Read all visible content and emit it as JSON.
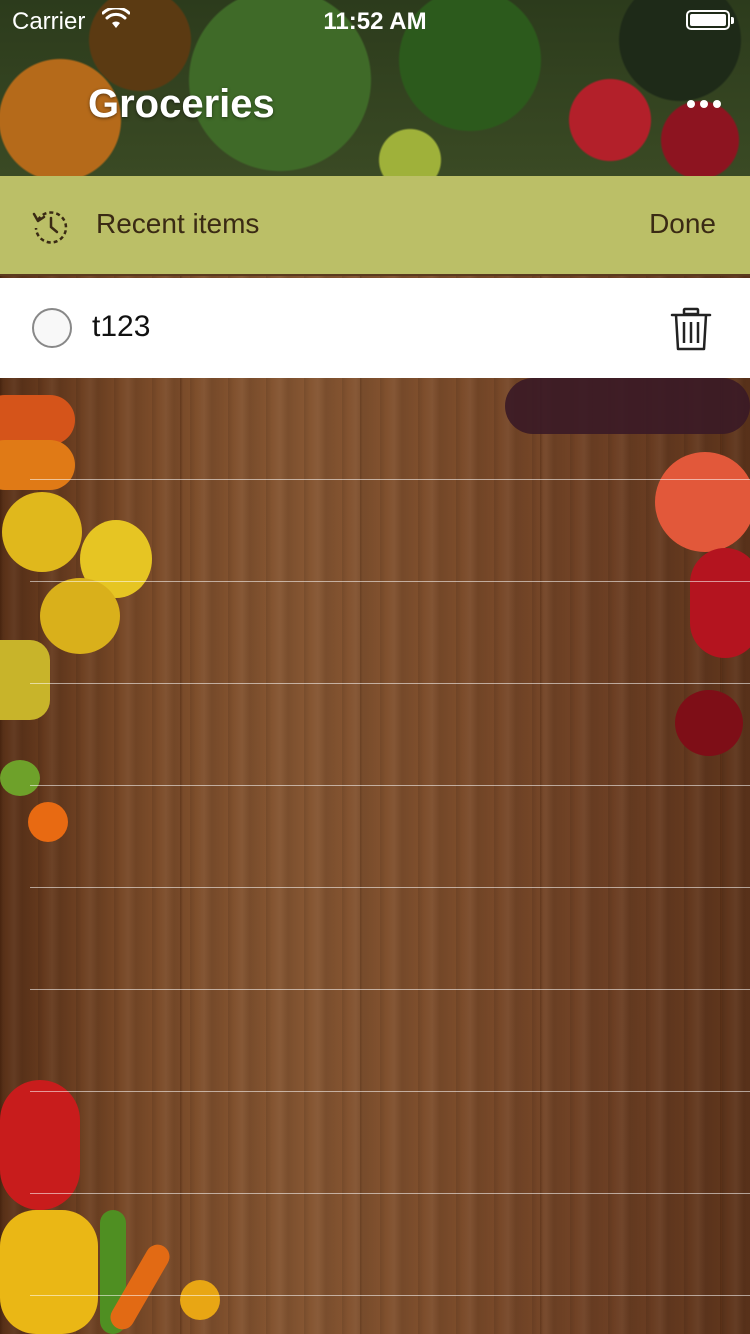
{
  "status_bar": {
    "carrier": "Carrier",
    "time": "11:52 AM"
  },
  "header": {
    "title": "Groceries"
  },
  "recent_bar": {
    "label": "Recent items",
    "done_label": "Done"
  },
  "items": [
    {
      "text": "t123",
      "checked": false
    }
  ],
  "colors": {
    "accent_bar": "#bbbf67",
    "bar_text": "#3a2a14"
  }
}
